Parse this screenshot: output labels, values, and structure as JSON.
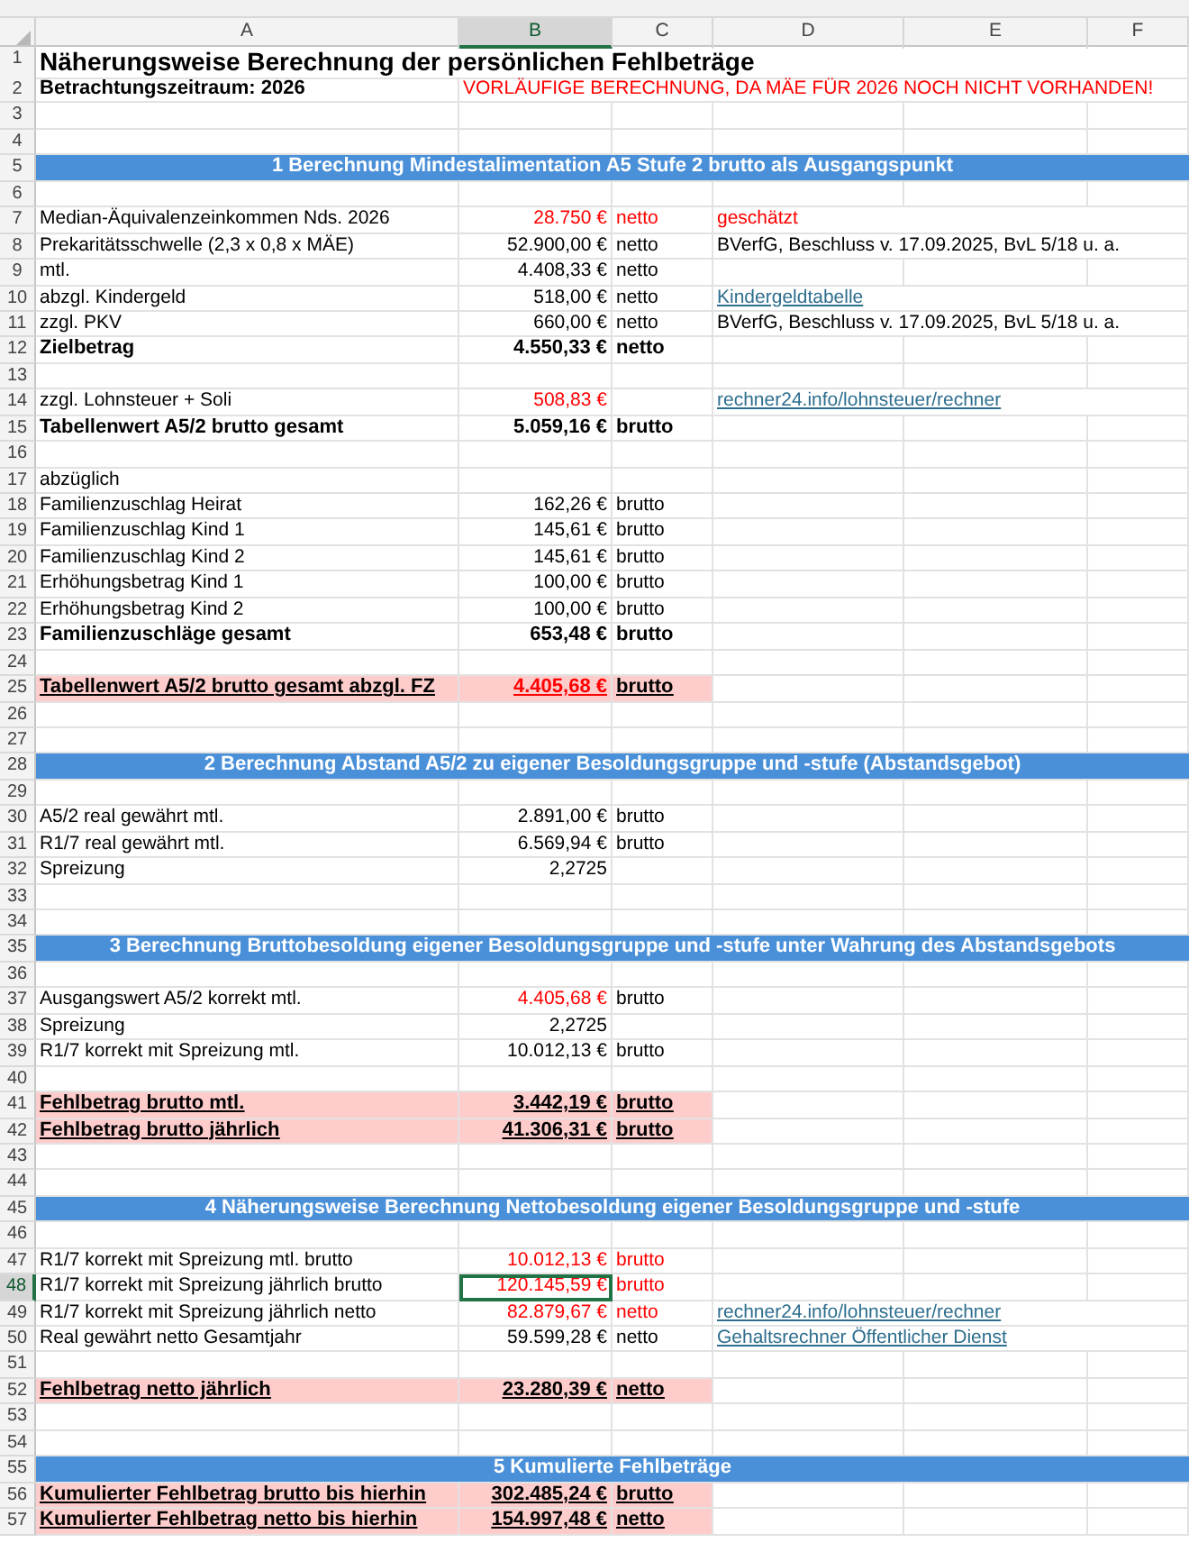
{
  "columns": [
    {
      "label": "A",
      "selected": false
    },
    {
      "label": "B",
      "selected": true
    },
    {
      "label": "C",
      "selected": false
    },
    {
      "label": "D",
      "selected": false
    },
    {
      "label": "E",
      "selected": false
    },
    {
      "label": "F",
      "selected": false
    }
  ],
  "rows": [
    {
      "number": "1",
      "kind": "title",
      "label": "Näherungsweise Berechnung der persönlichen Fehlbeträge",
      "selected": false
    },
    {
      "number": "2",
      "kind": "subtitle",
      "label": "Betrachtungszeitraum: 2026",
      "warning": "VORLÄUFIGE BERECHNUNG, DA MÄE FÜR 2026 NOCH NICHT VORHANDEN!",
      "selected": false
    },
    {
      "number": "3",
      "kind": "blank",
      "selected": false
    },
    {
      "number": "4",
      "kind": "blank",
      "selected": false
    },
    {
      "number": "5",
      "kind": "section",
      "label": "1 Berechnung Mindestalimentation A5 Stufe 2 brutto als Ausgangspunkt",
      "selected": false
    },
    {
      "number": "6",
      "kind": "blank",
      "selected": false
    },
    {
      "number": "7",
      "kind": "item",
      "label": "Median-Äquivalenzeinkommen Nds. 2026",
      "value": "28.750 €",
      "value_red": true,
      "unit": "netto",
      "unit_red": true,
      "note": "geschätzt",
      "note_link": false,
      "note_red": true,
      "selected": false
    },
    {
      "number": "8",
      "kind": "item",
      "label": "Prekaritätsschwelle (2,3 x 0,8 x MÄE)",
      "value": "52.900,00 €",
      "value_red": false,
      "unit": "netto",
      "unit_red": false,
      "note": "BVerfG, Beschluss v. 17.09.2025, BvL 5/18 u. a.",
      "note_link": false,
      "note_red": false,
      "selected": false
    },
    {
      "number": "9",
      "kind": "item",
      "label": "mtl.",
      "value": "4.408,33 €",
      "value_red": false,
      "unit": "netto",
      "unit_red": false,
      "selected": false
    },
    {
      "number": "10",
      "kind": "item",
      "label": "abzgl. Kindergeld",
      "value": "518,00 €",
      "value_red": false,
      "unit": "netto",
      "unit_red": false,
      "note": "Kindergeldtabelle",
      "note_link": true,
      "note_red": false,
      "selected": false
    },
    {
      "number": "11",
      "kind": "item",
      "label": "zzgl. PKV",
      "value": "660,00 €",
      "value_red": false,
      "unit": "netto",
      "unit_red": false,
      "note": "BVerfG, Beschluss v. 17.09.2025, BvL 5/18 u. a.",
      "note_link": false,
      "note_red": false,
      "selected": false
    },
    {
      "number": "12",
      "kind": "total",
      "label": "Zielbetrag",
      "value": "4.550,33 €",
      "value_red": false,
      "unit": "netto",
      "unit_red": false,
      "selected": false
    },
    {
      "number": "13",
      "kind": "blank",
      "selected": false
    },
    {
      "number": "14",
      "kind": "item",
      "label": "zzgl. Lohnsteuer + Soli",
      "value": "508,83 €",
      "value_red": true,
      "note": "rechner24.info/lohnsteuer/rechner",
      "note_link": true,
      "note_red": false,
      "selected": false
    },
    {
      "number": "15",
      "kind": "total",
      "label": "Tabellenwert A5/2 brutto gesamt",
      "value": "5.059,16 €",
      "value_red": false,
      "unit": "brutto",
      "unit_red": false,
      "selected": false
    },
    {
      "number": "16",
      "kind": "blank",
      "selected": false
    },
    {
      "number": "17",
      "kind": "item",
      "label": "abzüglich",
      "selected": false
    },
    {
      "number": "18",
      "kind": "item",
      "label": "Familienzuschlag Heirat",
      "value": "162,26 €",
      "value_red": false,
      "unit": "brutto",
      "unit_red": false,
      "selected": false
    },
    {
      "number": "19",
      "kind": "item",
      "label": "Familienzuschlag Kind 1",
      "value": "145,61 €",
      "value_red": false,
      "unit": "brutto",
      "unit_red": false,
      "selected": false
    },
    {
      "number": "20",
      "kind": "item",
      "label": "Familienzuschlag Kind 2",
      "value": "145,61 €",
      "value_red": false,
      "unit": "brutto",
      "unit_red": false,
      "selected": false
    },
    {
      "number": "21",
      "kind": "item",
      "label": "Erhöhungsbetrag Kind 1",
      "value": "100,00 €",
      "value_red": false,
      "unit": "brutto",
      "unit_red": false,
      "selected": false
    },
    {
      "number": "22",
      "kind": "item",
      "label": "Erhöhungsbetrag Kind 2",
      "value": "100,00 €",
      "value_red": false,
      "unit": "brutto",
      "unit_red": false,
      "selected": false
    },
    {
      "number": "23",
      "kind": "total",
      "label": "Familienzuschläge gesamt",
      "value": "653,48 €",
      "value_red": false,
      "unit": "brutto",
      "unit_red": false,
      "selected": false
    },
    {
      "number": "24",
      "kind": "blank",
      "selected": false
    },
    {
      "number": "25",
      "kind": "result",
      "label": "Tabellenwert A5/2 brutto gesamt abzgl. FZ",
      "value": "4.405,68 €",
      "value_red": true,
      "unit": "brutto",
      "unit_red": false,
      "selected": false
    },
    {
      "number": "26",
      "kind": "blank",
      "selected": false
    },
    {
      "number": "27",
      "kind": "blank",
      "selected": false
    },
    {
      "number": "28",
      "kind": "section",
      "label": "2 Berechnung Abstand A5/2 zu eigener Besoldungsgruppe und -stufe (Abstandsgebot)",
      "selected": false
    },
    {
      "number": "29",
      "kind": "blank",
      "selected": false
    },
    {
      "number": "30",
      "kind": "item",
      "label": "A5/2 real gewährt mtl.",
      "value": "2.891,00 €",
      "value_red": false,
      "unit": "brutto",
      "unit_red": false,
      "selected": false
    },
    {
      "number": "31",
      "kind": "item",
      "label": "R1/7 real gewährt mtl.",
      "value": "6.569,94 €",
      "value_red": false,
      "unit": "brutto",
      "unit_red": false,
      "selected": false
    },
    {
      "number": "32",
      "kind": "item",
      "label": "Spreizung",
      "value": "2,2725",
      "value_red": false,
      "selected": false
    },
    {
      "number": "33",
      "kind": "blank",
      "selected": false
    },
    {
      "number": "34",
      "kind": "blank",
      "selected": false
    },
    {
      "number": "35",
      "kind": "section",
      "label": "3 Berechnung Bruttobesoldung eigener Besoldungsgruppe und -stufe unter Wahrung des Abstandsgebots",
      "selected": false
    },
    {
      "number": "36",
      "kind": "blank",
      "selected": false
    },
    {
      "number": "37",
      "kind": "item",
      "label": "Ausgangswert A5/2 korrekt mtl.",
      "value": "4.405,68 €",
      "value_red": true,
      "unit": "brutto",
      "unit_red": false,
      "selected": false
    },
    {
      "number": "38",
      "kind": "item",
      "label": "Spreizung",
      "value": "2,2725",
      "value_red": false,
      "selected": false
    },
    {
      "number": "39",
      "kind": "item",
      "label": "R1/7 korrekt mit Spreizung mtl.",
      "value": "10.012,13 €",
      "value_red": false,
      "unit": "brutto",
      "unit_red": false,
      "selected": false
    },
    {
      "number": "40",
      "kind": "blank",
      "selected": false
    },
    {
      "number": "41",
      "kind": "result",
      "label": "Fehlbetrag brutto mtl.",
      "value": "3.442,19 €",
      "value_red": false,
      "unit": "brutto",
      "unit_red": false,
      "selected": false
    },
    {
      "number": "42",
      "kind": "result",
      "label": "Fehlbetrag brutto jährlich",
      "value": "41.306,31 €",
      "value_red": false,
      "unit": "brutto",
      "unit_red": false,
      "selected": false
    },
    {
      "number": "43",
      "kind": "blank",
      "selected": false
    },
    {
      "number": "44",
      "kind": "blank",
      "selected": false
    },
    {
      "number": "45",
      "kind": "section",
      "label": "4 Näherungsweise Berechnung Nettobesoldung eigener Besoldungsgruppe und -stufe",
      "selected": false
    },
    {
      "number": "46",
      "kind": "blank",
      "selected": false
    },
    {
      "number": "47",
      "kind": "item",
      "label": "R1/7 korrekt mit Spreizung mtl. brutto",
      "value": "10.012,13 €",
      "value_red": true,
      "unit": "brutto",
      "unit_red": true,
      "selected": false
    },
    {
      "number": "48",
      "kind": "item",
      "label": "R1/7 korrekt mit Spreizung jährlich brutto",
      "value": "120.145,59 €",
      "value_red": true,
      "unit": "brutto",
      "unit_red": true,
      "selected": true
    },
    {
      "number": "49",
      "kind": "item",
      "label": "R1/7 korrekt mit Spreizung jährlich netto",
      "value": "82.879,67 €",
      "value_red": true,
      "unit": "netto",
      "unit_red": true,
      "note": "rechner24.info/lohnsteuer/rechner",
      "note_link": true,
      "note_red": false,
      "selected": false
    },
    {
      "number": "50",
      "kind": "item",
      "label": "Real gewährt netto Gesamtjahr",
      "value": "59.599,28 €",
      "value_red": false,
      "unit": "netto",
      "unit_red": false,
      "note": "Gehaltsrechner Öffentlicher Dienst",
      "note_link": true,
      "note_red": false,
      "selected": false
    },
    {
      "number": "51",
      "kind": "blank",
      "selected": false
    },
    {
      "number": "52",
      "kind": "result",
      "label": "Fehlbetrag netto jährlich",
      "value": "23.280,39 €",
      "value_red": false,
      "unit": "netto",
      "unit_red": false,
      "selected": false
    },
    {
      "number": "53",
      "kind": "blank",
      "selected": false
    },
    {
      "number": "54",
      "kind": "blank",
      "selected": false
    },
    {
      "number": "55",
      "kind": "section",
      "label": "5 Kumulierte Fehlbeträge",
      "selected": false
    },
    {
      "number": "56",
      "kind": "result",
      "label": "Kumulierter Fehlbetrag brutto bis hierhin",
      "value": "302.485,24 €",
      "value_red": false,
      "unit": "brutto",
      "unit_red": false,
      "selected": false
    },
    {
      "number": "57",
      "kind": "result",
      "label": "Kumulierter Fehlbetrag netto bis hierhin",
      "value": "154.997,48 €",
      "value_red": false,
      "unit": "netto",
      "unit_red": false,
      "selected": false
    }
  ]
}
